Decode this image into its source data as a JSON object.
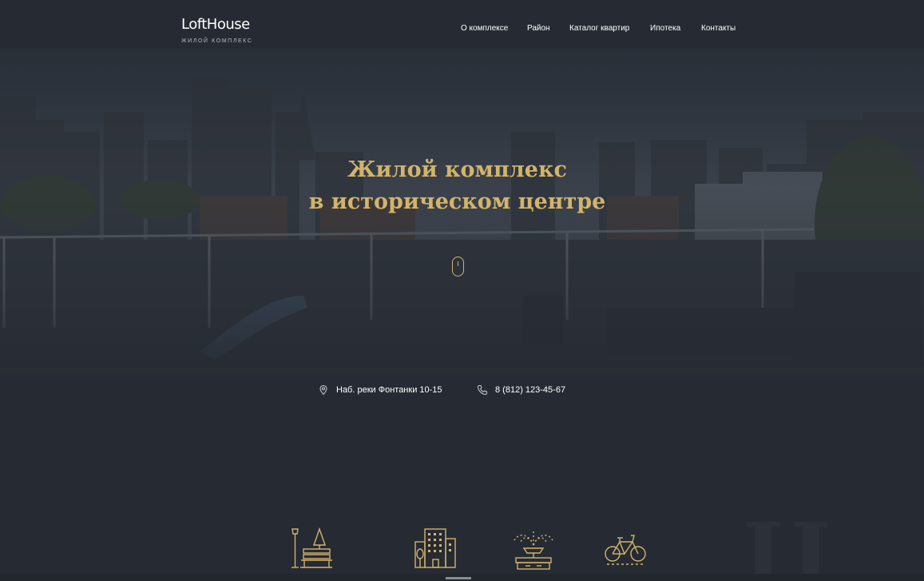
{
  "header": {
    "logo_title": "LoftHouse",
    "logo_subtitle": "жилой комплекс",
    "nav": [
      {
        "label": "О комплексе"
      },
      {
        "label": "Район"
      },
      {
        "label": "Каталог квартир"
      },
      {
        "label": "Ипотека"
      },
      {
        "label": "Контакты"
      }
    ]
  },
  "hero": {
    "title_line1": "Жилой комплекс",
    "title_line2": "в историческом центре",
    "scroll_icon": "mouse-icon"
  },
  "contacts": {
    "address": "Наб. реки Фонтанки 10-15",
    "address_icon": "location-pin-icon",
    "phone": "8 (812) 123-45-67",
    "phone_icon": "phone-icon"
  },
  "features": {
    "icons": [
      "park-bench-icon",
      "building-icon",
      "fountain-icon",
      "bicycle-icon"
    ],
    "background_numeral": "II"
  },
  "colors": {
    "background": "#262b33",
    "accent_gold": "#d2b46a",
    "text_white": "#ffffff"
  }
}
